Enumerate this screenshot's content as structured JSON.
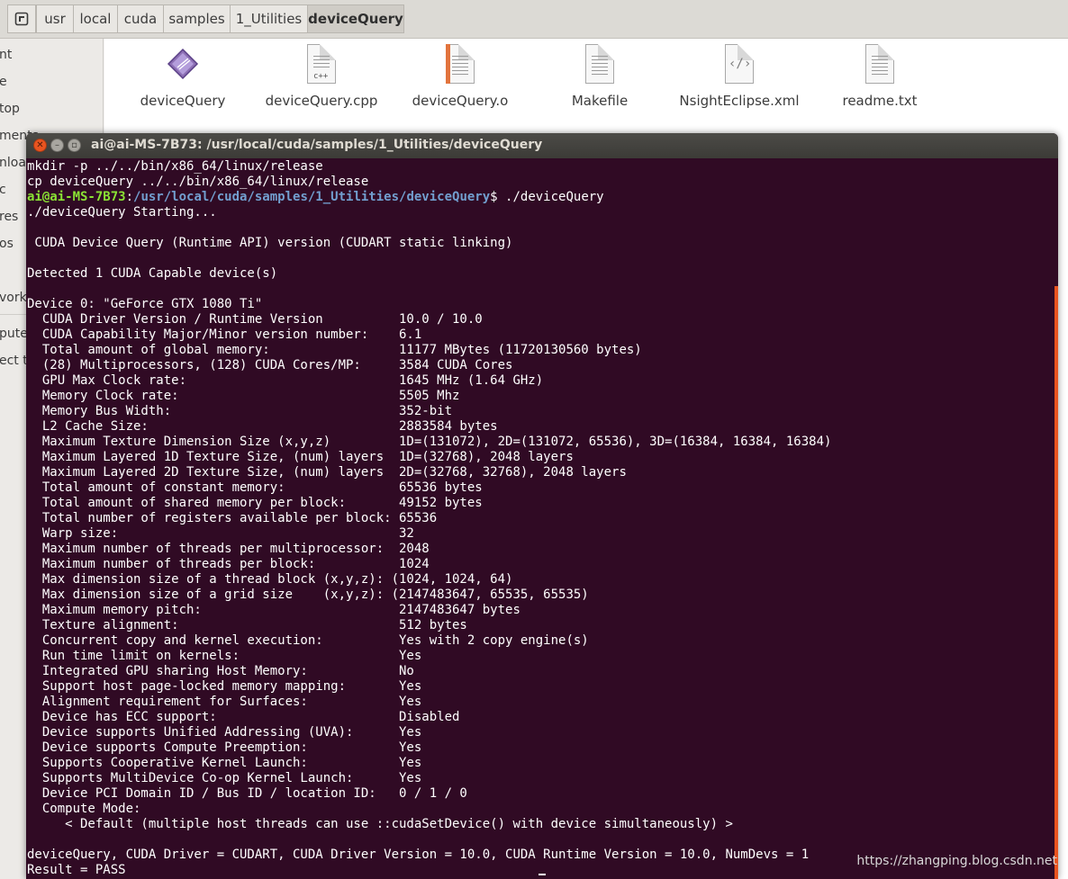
{
  "breadcrumbs": [
    "usr",
    "local",
    "cuda",
    "samples",
    "1_Utilities",
    "deviceQuery"
  ],
  "sidebar": {
    "items": [
      {
        "label": "nt"
      },
      {
        "label": "e"
      },
      {
        "label": "top"
      },
      {
        "label": "ments"
      },
      {
        "label": "nloads"
      },
      {
        "label": "c"
      },
      {
        "label": "res"
      },
      {
        "label": "os"
      },
      {
        "label": "vork"
      },
      {
        "label": "puter"
      },
      {
        "label": "ect t"
      }
    ]
  },
  "files": [
    {
      "name": "deviceQuery",
      "icon": "executable-icon"
    },
    {
      "name": "deviceQuery.cpp",
      "icon": "cpp-source-icon"
    },
    {
      "name": "deviceQuery.o",
      "icon": "object-file-icon"
    },
    {
      "name": "Makefile",
      "icon": "text-file-icon"
    },
    {
      "name": "NsightEclipse.xml",
      "icon": "xml-file-icon"
    },
    {
      "name": "readme.txt",
      "icon": "text-file-icon"
    }
  ],
  "terminal": {
    "title": "ai@ai-MS-7B73: /usr/local/cuda/samples/1_Utilities/deviceQuery",
    "prompt": {
      "user": "ai@ai-MS-7B73",
      "separator": ":",
      "path": "/usr/local/cuda/samples/1_Utilities/deviceQuery",
      "symbol": "$ ",
      "command": "./deviceQuery"
    },
    "lines": [
      "mkdir -p ../../bin/x86_64/linux/release",
      "cp deviceQuery ../../bin/x86_64/linux/release",
      "",
      "./deviceQuery Starting...",
      "",
      " CUDA Device Query (Runtime API) version (CUDART static linking)",
      "",
      "Detected 1 CUDA Capable device(s)",
      "",
      "Device 0: \"GeForce GTX 1080 Ti\"",
      "  CUDA Driver Version / Runtime Version          10.0 / 10.0",
      "  CUDA Capability Major/Minor version number:    6.1",
      "  Total amount of global memory:                 11177 MBytes (11720130560 bytes)",
      "  (28) Multiprocessors, (128) CUDA Cores/MP:     3584 CUDA Cores",
      "  GPU Max Clock rate:                            1645 MHz (1.64 GHz)",
      "  Memory Clock rate:                             5505 Mhz",
      "  Memory Bus Width:                              352-bit",
      "  L2 Cache Size:                                 2883584 bytes",
      "  Maximum Texture Dimension Size (x,y,z)         1D=(131072), 2D=(131072, 65536), 3D=(16384, 16384, 16384)",
      "  Maximum Layered 1D Texture Size, (num) layers  1D=(32768), 2048 layers",
      "  Maximum Layered 2D Texture Size, (num) layers  2D=(32768, 32768), 2048 layers",
      "  Total amount of constant memory:               65536 bytes",
      "  Total amount of shared memory per block:       49152 bytes",
      "  Total number of registers available per block: 65536",
      "  Warp size:                                     32",
      "  Maximum number of threads per multiprocessor:  2048",
      "  Maximum number of threads per block:           1024",
      "  Max dimension size of a thread block (x,y,z): (1024, 1024, 64)",
      "  Max dimension size of a grid size    (x,y,z): (2147483647, 65535, 65535)",
      "  Maximum memory pitch:                          2147483647 bytes",
      "  Texture alignment:                             512 bytes",
      "  Concurrent copy and kernel execution:          Yes with 2 copy engine(s)",
      "  Run time limit on kernels:                     Yes",
      "  Integrated GPU sharing Host Memory:            No",
      "  Support host page-locked memory mapping:       Yes",
      "  Alignment requirement for Surfaces:            Yes",
      "  Device has ECC support:                        Disabled",
      "  Device supports Unified Addressing (UVA):      Yes",
      "  Device supports Compute Preemption:            Yes",
      "  Supports Cooperative Kernel Launch:            Yes",
      "  Supports MultiDevice Co-op Kernel Launch:      Yes",
      "  Device PCI Domain ID / Bus ID / location ID:   0 / 1 / 0",
      "  Compute Mode:",
      "     < Default (multiple host threads can use ::cudaSetDevice() with device simultaneously) >",
      "",
      "deviceQuery, CUDA Driver = CUDART, CUDA Driver Version = 10.0, CUDA Runtime Version = 10.0, NumDevs = 1",
      "Result = PASS"
    ]
  },
  "watermark": "https://zhangping.blog.csdn.net",
  "colors": {
    "terminal_bg": "#300a24",
    "prompt_user": "#8ae234",
    "prompt_path": "#729fcf",
    "ubuntu_orange": "#e95420"
  }
}
